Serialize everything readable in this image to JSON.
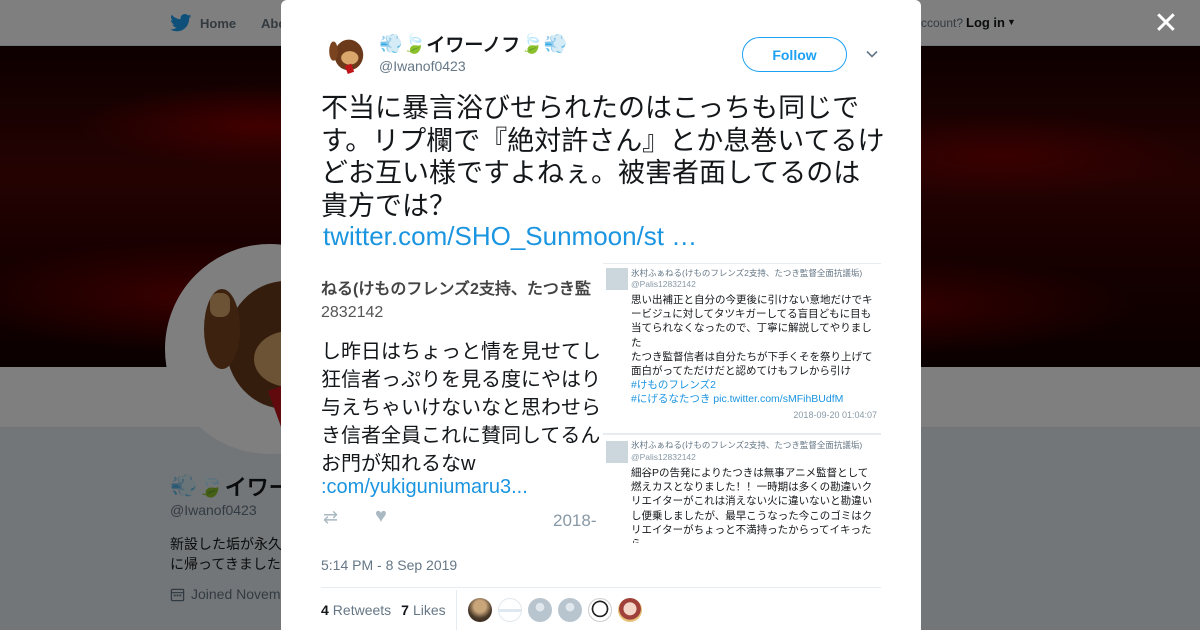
{
  "topbar": {
    "home_label": "Home",
    "about_label": "Abo",
    "account_text": "ccount?",
    "login_label": "Log in"
  },
  "profile": {
    "name_text": "イワーノフ",
    "handle": "@Iwanof0423",
    "bio_line1": "新設した垢が永久",
    "bio_line2": "に帰ってきました",
    "joined": "Joined Novem"
  },
  "tweet": {
    "author_name": "イワーノフ",
    "author_handle": "@Iwanof0423",
    "follow_label": "Follow",
    "text": "不当に暴言浴びせられたのはこっちも同じです。リプ欄で『絶対許さん』とか息巻いてるけどお互い様ですよねぇ。被害者面してるのは貴方では？",
    "link": "twitter.com/SHO_Sunmoon/st …",
    "timestamp": "5:14 PM - 8 Sep 2019",
    "retweets_count": "4",
    "retweets_label": "Retweets",
    "likes_count": "7",
    "likes_label": "Likes"
  },
  "media_left": {
    "line1": "ねる(けものフレンズ2支持、たつき監",
    "line2": "2832142",
    "line3": "し昨日はちょっと情を見せてし",
    "line4": "狂信者っぷりを見る度にやはり",
    "line5": "与えちゃいけないなと思わせら",
    "line6": "き信者全員これに賛同してるん",
    "line7": "お門が知れるなw",
    "link": ":com/yukiguniumaru3...",
    "date": "2018-"
  },
  "media_right": {
    "card1": {
      "name": "氷村ふぁねる(けものフレンズ2支持、たつき監督全面抗議垢)",
      "handle": "@Palis12832142",
      "body": "思い出補正と自分の今更後に引けない意地だけでキービジュに対してタツキガーしてる盲目どもに目も当てられなくなったので、丁寧に解説してやりました\nたつき監督信者は自分たちが下手くそを祭り上げて面白がってただけだと認めてけもフレから引け",
      "tag1": "#けものフレンズ2",
      "tag2": "#にげるなたつき",
      "pic": "pic.twitter.com/sMFihBUdfM",
      "date": "2018-09-20 01:04:07"
    },
    "card2": {
      "name": "氷村ふぁねる(けものフレンズ2支持、たつき監督全面抗議垢)",
      "handle": "@Palis12832142",
      "body": "細谷Pの告発によりたつきは無事アニメ監督として燃えカスとなりました！！一時期は多くの勘違いクリエイターがこれは消えない火に違いないと勘違いし便乗しましたが、最早こうなった今このゴミはクリエイターがちょっと不満持ったからってイキったら"
    }
  },
  "colors": {
    "twitter_blue": "#1da1f2",
    "link_blue": "#1b95e0",
    "banner_red": "#8b0000"
  },
  "icons": {
    "brand": "twitter-bird-icon",
    "close": "close-icon",
    "caret": "chevron-down-icon",
    "calendar": "calendar-icon",
    "emoji": "dash-leaf-emoji"
  }
}
